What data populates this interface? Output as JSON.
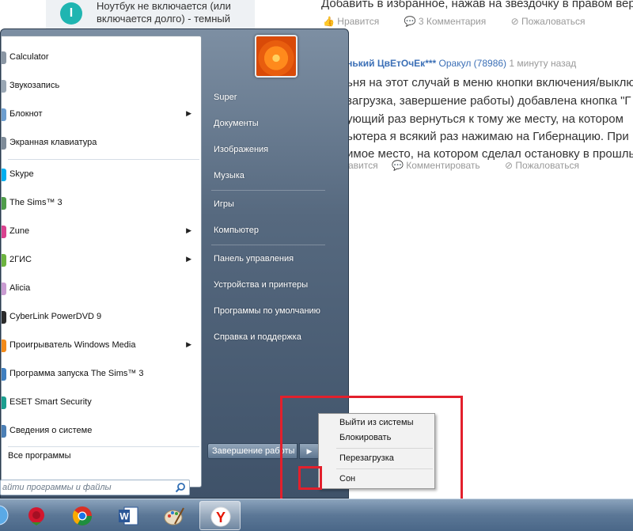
{
  "background_page": {
    "notification": {
      "icon_letter": "I",
      "text_line1": "Ноутбук не включается (или",
      "text_line2": "включается долго) - темный"
    },
    "top_comment": {
      "text": "Добавить в избранное, нажав на звездочку в правом вер",
      "like": "Нравится",
      "comments": "3 Комментария",
      "report": "Пожаловаться"
    },
    "reply": {
      "author": "ленький ЦвЕтОчЕк***",
      "role": "Оракул (78986)",
      "time": "1 минуту назад",
      "lines": [
        "ьня на этот случай в меню кнопки включения/выклю",
        "загрузка, завершение работы) добавлена кнопка \"Г",
        "ующий раз вернуться к тому же месту, на котором",
        "ьютера я всякий раз нажимаю на Гибернацию. При",
        "имое место, на котором сделал остановку в прошль"
      ],
      "like": "авится",
      "comment": "Комментировать",
      "report": "Пожаловаться"
    }
  },
  "start_menu": {
    "programs": [
      {
        "label": "Calculator",
        "icon_color": "#8a96a3",
        "has_submenu": false
      },
      {
        "label": "Звукозапись",
        "icon_color": "#9aa7b4",
        "has_submenu": false
      },
      {
        "label": "Блокнот",
        "icon_color": "#6d9ecf",
        "has_submenu": true
      },
      {
        "label": "Экранная клавиатура",
        "icon_color": "#7f8c99",
        "has_submenu": false
      },
      {
        "label": "Skype",
        "icon_color": "#00aff0",
        "has_submenu": false
      },
      {
        "label": "The Sims™ 3",
        "icon_color": "#4f9d4a",
        "has_submenu": false
      },
      {
        "label": "Zune",
        "icon_color": "#d9428f",
        "has_submenu": true
      },
      {
        "label": "2ГИС",
        "icon_color": "#6cb33f",
        "has_submenu": true
      },
      {
        "label": "Alicia",
        "icon_color": "#c99bd1",
        "has_submenu": false
      },
      {
        "label": "CyberLink PowerDVD 9",
        "icon_color": "#2b2b2b",
        "has_submenu": false
      },
      {
        "label": "Проигрыватель Windows Media",
        "icon_color": "#f28a1a",
        "has_submenu": true
      },
      {
        "label": "Программа запуска The Sims™ 3",
        "icon_color": "#3f7fbf",
        "has_submenu": false
      },
      {
        "label": "ESET Smart Security",
        "icon_color": "#1b9e8f",
        "has_submenu": false
      },
      {
        "label": "Сведения о системе",
        "icon_color": "#4b7fb5",
        "has_submenu": false
      }
    ],
    "all_programs": "Все программы",
    "search_placeholder": "айти программы и файлы",
    "right_items": [
      "Super",
      "Документы",
      "Изображения",
      "Музыка",
      "Игры",
      "Компьютер",
      "Панель управления",
      "Устройства и принтеры",
      "Программы по умолчанию",
      "Справка и поддержка"
    ],
    "shutdown_label": "Завершение работы",
    "shutdown_arrow": "▶"
  },
  "context_menu": {
    "items": [
      "Выйти из системы",
      "Блокировать",
      "Перезагрузка",
      "Сон"
    ]
  },
  "taskbar": {
    "items": [
      {
        "icon": "rose-app-icon",
        "active": false
      },
      {
        "icon": "chrome-icon",
        "active": false
      },
      {
        "icon": "word-icon",
        "active": false
      },
      {
        "icon": "paint-icon",
        "active": false
      },
      {
        "icon": "yandex-browser-icon",
        "active": true
      }
    ]
  },
  "colors": {
    "annotation_red": "#e3202c",
    "link_blue": "#3b6fb6"
  }
}
